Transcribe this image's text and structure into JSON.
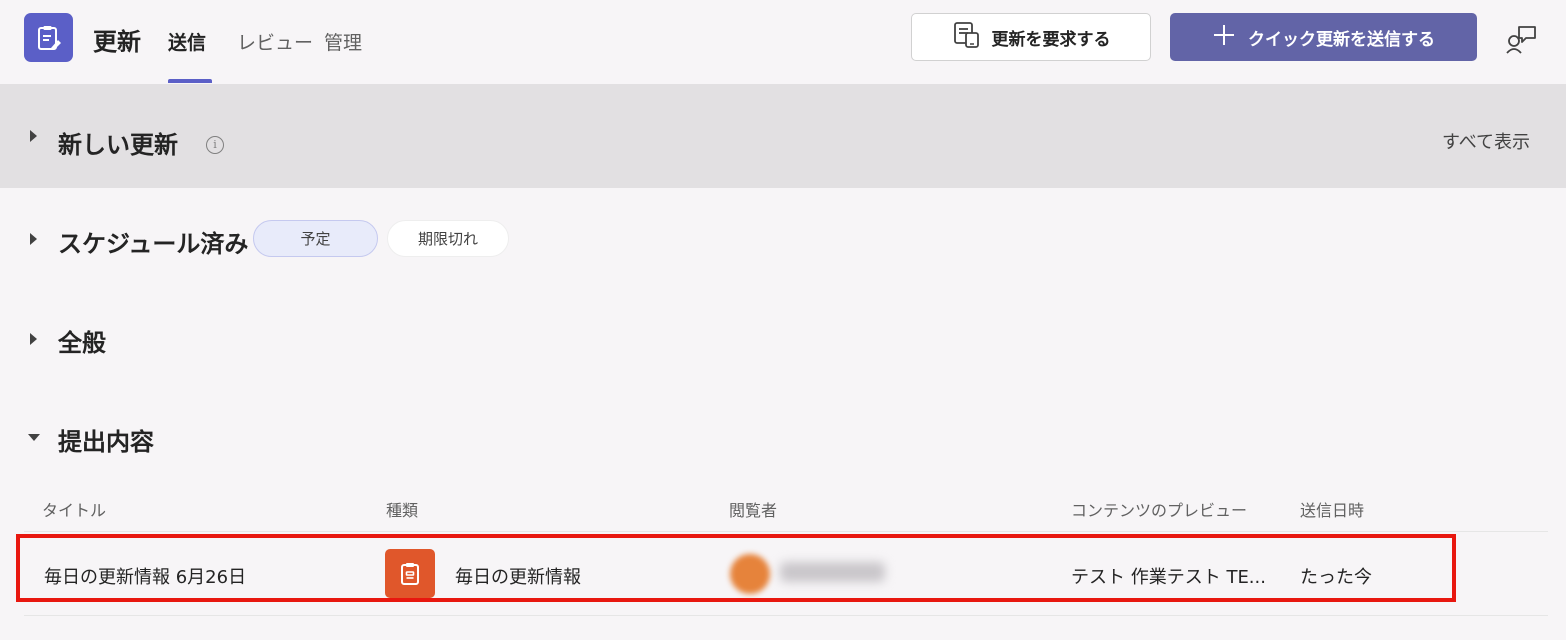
{
  "header": {
    "app_title": "更新",
    "tabs": [
      {
        "label": "送信",
        "active": true
      },
      {
        "label": "レビュー",
        "active": false
      },
      {
        "label": "管理",
        "active": false
      }
    ],
    "request_button": "更新を要求する",
    "send_button": "クイック更新を送信する"
  },
  "sections": {
    "new_updates": {
      "title": "新しい更新",
      "show_all": "すべて表示",
      "expanded": false
    },
    "scheduled": {
      "title": "スケジュール済み",
      "expanded": false,
      "filters": [
        "予定",
        "期限切れ"
      ],
      "selected_filter": "予定"
    },
    "general": {
      "title": "全般",
      "expanded": false
    },
    "submissions": {
      "title": "提出内容",
      "expanded": true
    }
  },
  "table": {
    "columns": [
      "タイトル",
      "種類",
      "閲覧者",
      "コンテンツのプレビュー",
      "送信日時"
    ],
    "rows": [
      {
        "title": "毎日の更新情報 6月26日",
        "type": "毎日の更新情報",
        "preview": "テスト 作業テスト TE...",
        "sent": "たった今"
      }
    ]
  },
  "colors": {
    "brand": "#5b5fc7",
    "primary_button": "#6264a7",
    "type_icon": "#e0572b",
    "highlight_border": "#e8170f"
  },
  "icons": [
    "clipboard-edit-icon",
    "request-form-icon",
    "plus-icon",
    "chat-people-icon",
    "info-icon",
    "clipboard-icon"
  ]
}
